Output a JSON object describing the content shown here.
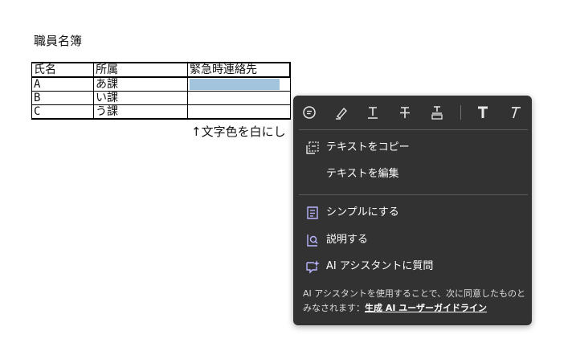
{
  "document": {
    "title": "職員名簿",
    "table": {
      "headers": [
        "氏名",
        "所属",
        "緊急時連絡先"
      ],
      "rows": [
        [
          "A",
          "あ課",
          ""
        ],
        [
          "B",
          "い課",
          ""
        ],
        [
          "C",
          "う課",
          ""
        ]
      ]
    },
    "note": "↑文字色を白にし"
  },
  "context_menu": {
    "toolbar": [
      "comment-icon",
      "highlight-icon",
      "underline-icon",
      "strikethrough-icon",
      "replace-text-icon",
      "bold-text-icon",
      "italic-text-icon"
    ],
    "items": [
      {
        "label": "テキストをコピー",
        "icon": "copy-text-icon"
      },
      {
        "label": "テキストを編集",
        "icon": ""
      },
      {
        "label": "シンプルにする",
        "icon": "simplify-icon"
      },
      {
        "label": "説明する",
        "icon": "explain-icon"
      },
      {
        "label": "AI アシスタントに質問",
        "icon": "ai-assistant-icon"
      }
    ],
    "footer_text": "AI アシスタントを使用することで、次に同意したものとみなされます：",
    "footer_link": "生成 AI ユーザーガイドライン"
  },
  "colors": {
    "menu_bg": "#323232",
    "selection": "#a3c4dd",
    "menu_text": "#ffffff"
  }
}
